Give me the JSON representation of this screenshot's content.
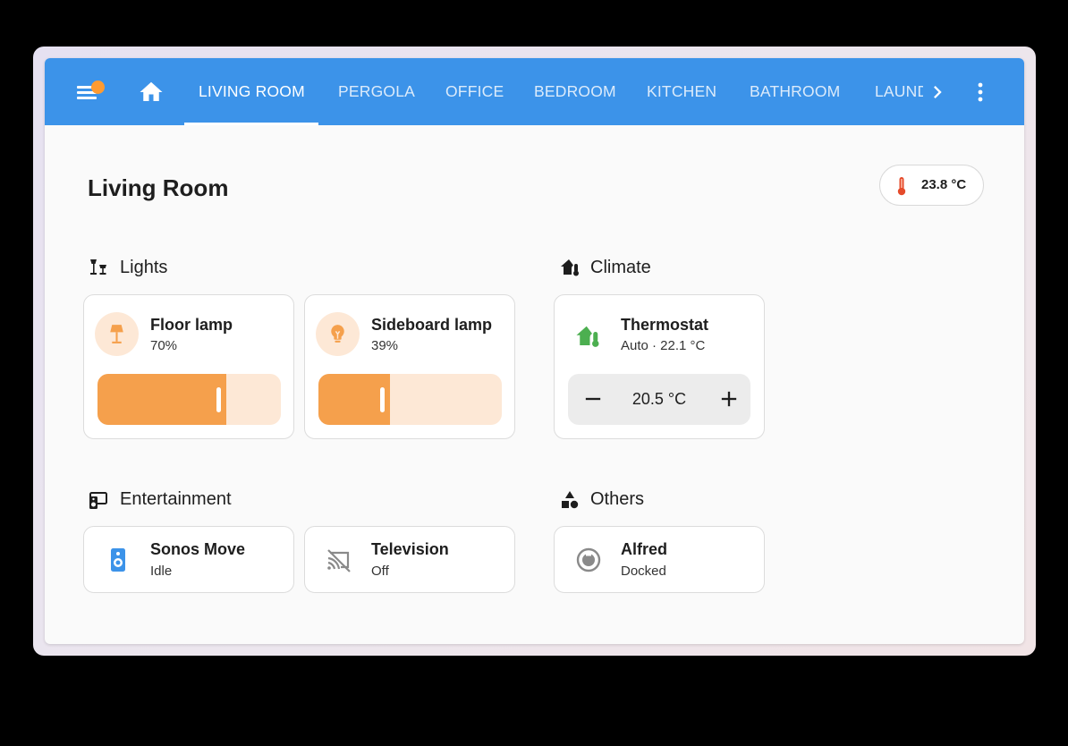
{
  "header": {
    "menu_icon": "menu-icon",
    "home_icon": "home-icon",
    "tabs": [
      {
        "label": "LIVING ROOM",
        "active": true
      },
      {
        "label": "PERGOLA",
        "active": false
      },
      {
        "label": "OFFICE",
        "active": false
      },
      {
        "label": "BEDROOM",
        "active": false
      },
      {
        "label": "KITCHEN",
        "active": false
      },
      {
        "label": "BATHROOM",
        "active": false
      },
      {
        "label": "LAUNDRY",
        "active": false
      }
    ],
    "scroll_icon": "chevron-right-icon",
    "more_icon": "more-vertical-icon",
    "colors": {
      "bar": "#3c93e9",
      "notification": "#ff9b31"
    }
  },
  "page": {
    "title": "Living Room",
    "temperature": "23.8 °C",
    "temperature_icon": "thermometer-icon"
  },
  "sections": {
    "lights": {
      "title": "Lights",
      "icon": "lamps-icon",
      "cards": [
        {
          "name": "Floor lamp",
          "state": "70%",
          "brightness": 70,
          "icon": "floor-lamp-icon"
        },
        {
          "name": "Sideboard lamp",
          "state": "39%",
          "brightness": 39,
          "icon": "lightbulb-icon"
        }
      ]
    },
    "climate": {
      "title": "Climate",
      "icon": "home-thermometer-icon",
      "card": {
        "name": "Thermostat",
        "state": "Auto · 22.1 °C",
        "target": "20.5 °C",
        "icon": "home-thermometer-icon"
      }
    },
    "entertainment": {
      "title": "Entertainment",
      "icon": "speaker-tv-icon",
      "cards": [
        {
          "name": "Sonos Move",
          "state": "Idle",
          "icon": "speaker-icon"
        },
        {
          "name": "Television",
          "state": "Off",
          "icon": "cast-off-icon"
        }
      ]
    },
    "others": {
      "title": "Others",
      "icon": "shapes-icon",
      "card": {
        "name": "Alfred",
        "state": "Docked",
        "icon": "robot-vacuum-icon"
      }
    }
  },
  "colors": {
    "light_accent": "#f5a04c",
    "light_track": "#fde8d6",
    "climate_green": "#4caf50",
    "media_blue": "#3c93e9",
    "thermo_red": "#e54b2b"
  }
}
